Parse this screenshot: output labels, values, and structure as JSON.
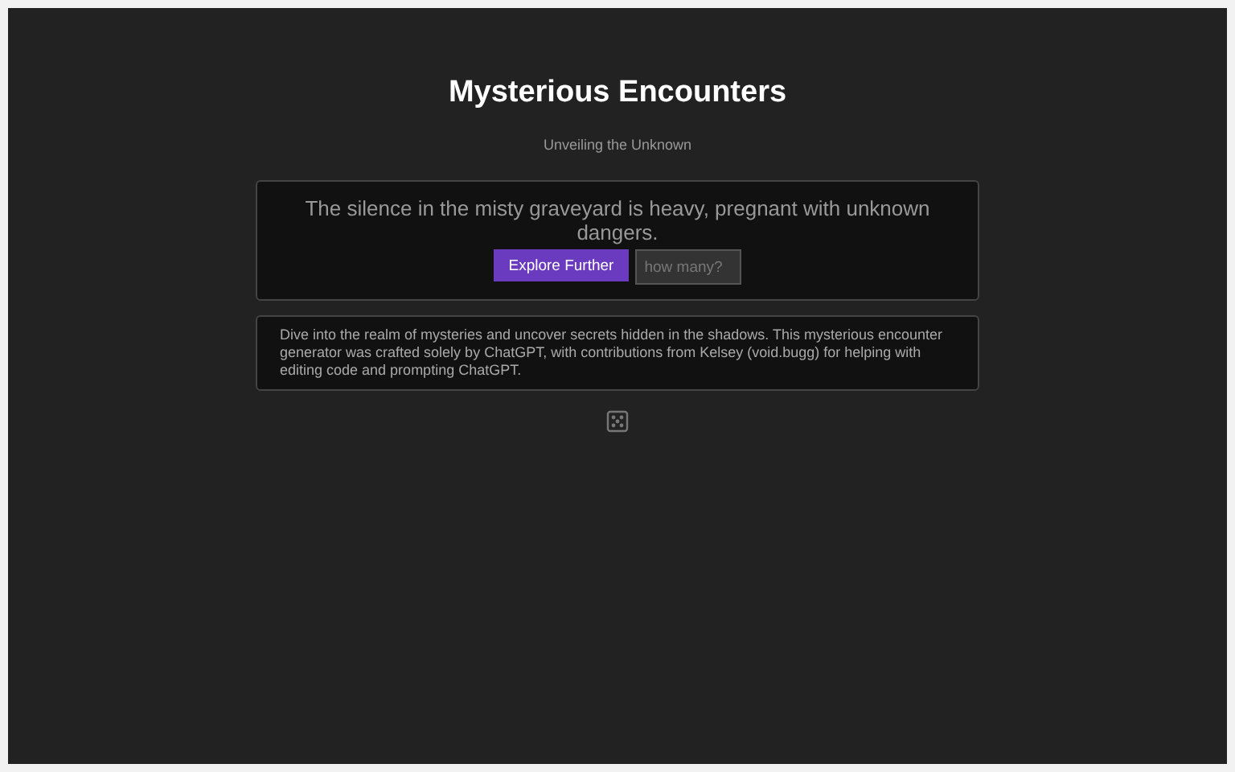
{
  "header": {
    "title": "Mysterious Encounters",
    "subtitle": "Unveiling the Unknown"
  },
  "encounter": {
    "text": "The silence in the misty graveyard is heavy, pregnant with unknown dangers.",
    "button": "Explore Further",
    "count_field": {
      "placeholder": "how many?"
    }
  },
  "about": {
    "text": "Dive into the realm of mysteries and uncover secrets hidden in the shadows. This mysterious encounter generator was crafted solely by ChatGPT, with contributions from Kelsey (void.bugg) for helping with editing code and prompting ChatGPT."
  }
}
